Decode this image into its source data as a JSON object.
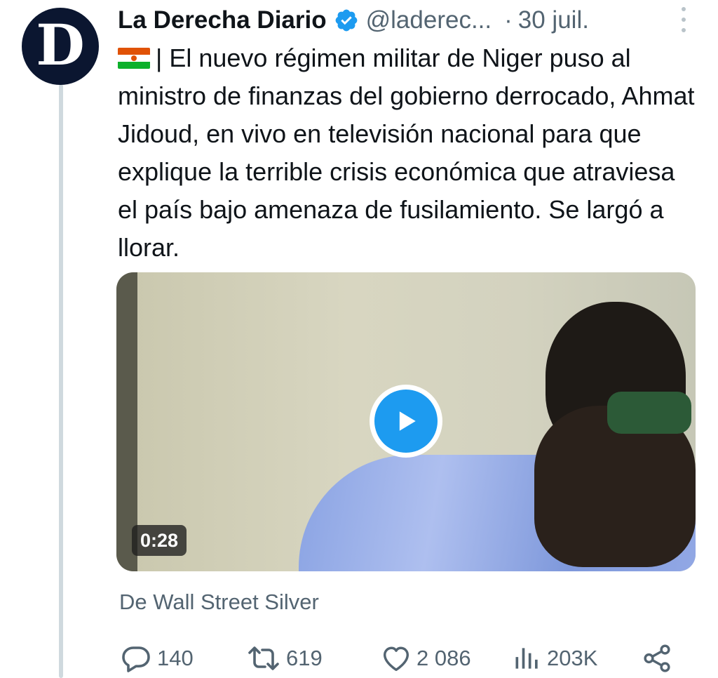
{
  "author": {
    "name": "La Derecha Diario",
    "handle": "@laderec...",
    "separator": "·",
    "date": "30 juil.",
    "avatar_letter": "D",
    "verified_color": "#1d9bf0"
  },
  "tweet": {
    "text": "| El nuevo régimen militar de Niger puso al ministro de finanzas del gobierno derrocado, Ahmat Jidoud, en vivo en televisión nacional para que explique la terrible crisis económica que atraviesa el país bajo amenaza de fusilamiento. Se largó a llorar.",
    "flag": "niger-flag"
  },
  "media": {
    "duration": "0:28",
    "play_icon": "play-icon"
  },
  "source_label": "De Wall Street Silver",
  "actions": {
    "replies": "140",
    "retweets": "619",
    "likes": "2 086",
    "views": "203K"
  },
  "colors": {
    "accent": "#1d9bf0",
    "muted_text": "#536471",
    "text": "#0f1419",
    "thread_line": "#cfd9de"
  }
}
